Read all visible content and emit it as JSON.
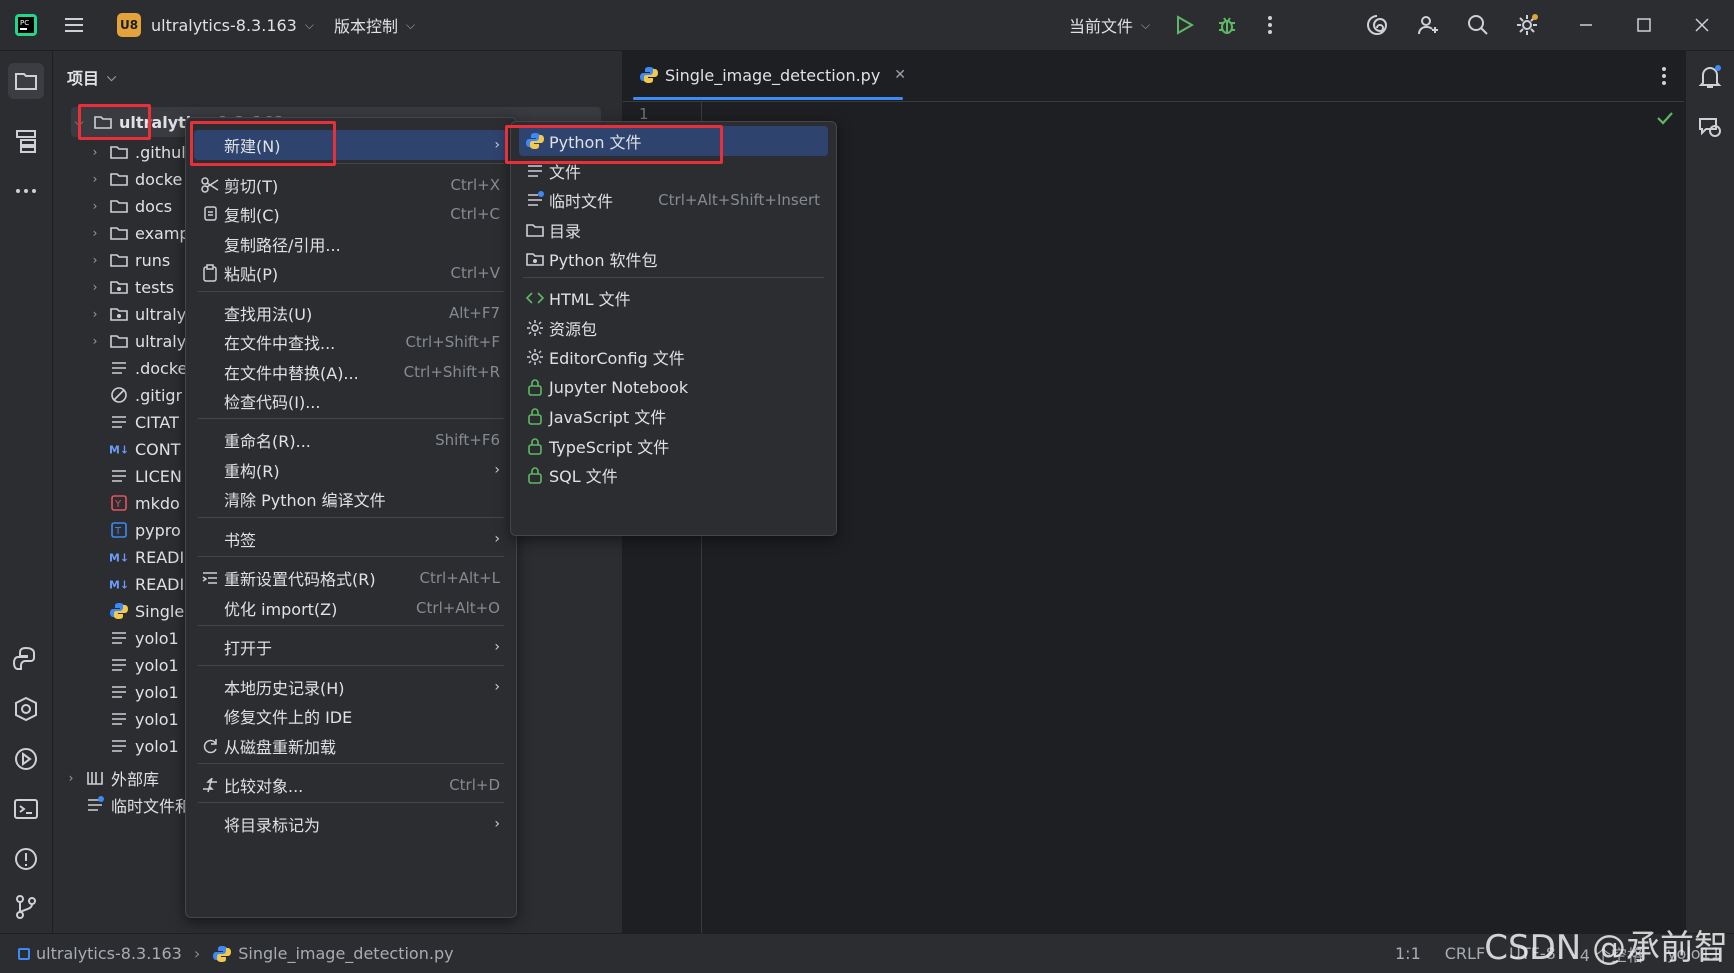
{
  "titlebar": {
    "project_badge": "U8",
    "project_name": "ultralytics-8.3.163",
    "vcs_label": "版本控制",
    "run_config": "当前文件"
  },
  "project_panel": {
    "title": "项目",
    "root_label": "ultralytics-8.3.163",
    "items": [
      {
        "label": ".githul",
        "type": "folder"
      },
      {
        "label": "docke",
        "type": "folder"
      },
      {
        "label": "docs",
        "type": "folder"
      },
      {
        "label": "examp",
        "type": "folder"
      },
      {
        "label": "runs",
        "type": "folder"
      },
      {
        "label": "tests",
        "type": "package"
      },
      {
        "label": "ultraly",
        "type": "package"
      },
      {
        "label": "ultraly",
        "type": "folder"
      },
      {
        "label": ".docke",
        "type": "text"
      },
      {
        "label": ".gitigr",
        "type": "ignore"
      },
      {
        "label": "CITAT",
        "type": "text"
      },
      {
        "label": "CONT",
        "type": "markdown"
      },
      {
        "label": "LICEN",
        "type": "text"
      },
      {
        "label": "mkdo",
        "type": "yaml"
      },
      {
        "label": "pypro",
        "type": "toml"
      },
      {
        "label": "READI",
        "type": "markdown"
      },
      {
        "label": "READI",
        "type": "markdown"
      },
      {
        "label": "Single",
        "type": "python"
      },
      {
        "label": "yolo1",
        "type": "text"
      },
      {
        "label": "yolo1",
        "type": "text"
      },
      {
        "label": "yolo1",
        "type": "text"
      },
      {
        "label": "yolo1",
        "type": "text"
      },
      {
        "label": "yolo1",
        "type": "text"
      }
    ],
    "external_libs": "外部库",
    "scratch": "临时文件和"
  },
  "editor": {
    "tab_label": "Single_image_detection.py",
    "line_number": "1"
  },
  "context_menu": {
    "items": [
      {
        "label": "新建(N)",
        "shortcut": "",
        "submenu": true
      },
      {
        "label": "剪切(T)",
        "shortcut": "Ctrl+X"
      },
      {
        "label": "复制(C)",
        "shortcut": "Ctrl+C"
      },
      {
        "label": "复制路径/引用...",
        "shortcut": ""
      },
      {
        "label": "粘贴(P)",
        "shortcut": "Ctrl+V"
      },
      {
        "label": "查找用法(U)",
        "shortcut": "Alt+F7"
      },
      {
        "label": "在文件中查找...",
        "shortcut": "Ctrl+Shift+F"
      },
      {
        "label": "在文件中替换(A)...",
        "shortcut": "Ctrl+Shift+R"
      },
      {
        "label": "检查代码(I)...",
        "shortcut": ""
      },
      {
        "label": "重命名(R)...",
        "shortcut": "Shift+F6"
      },
      {
        "label": "重构(R)",
        "shortcut": "",
        "submenu": true
      },
      {
        "label": "清除 Python 编译文件",
        "shortcut": ""
      },
      {
        "label": "书签",
        "shortcut": "",
        "submenu": true
      },
      {
        "label": "重新设置代码格式(R)",
        "shortcut": "Ctrl+Alt+L"
      },
      {
        "label": "优化 import(Z)",
        "shortcut": "Ctrl+Alt+O"
      },
      {
        "label": "打开于",
        "shortcut": "",
        "submenu": true
      },
      {
        "label": "本地历史记录(H)",
        "shortcut": "",
        "submenu": true
      },
      {
        "label": "修复文件上的 IDE",
        "shortcut": ""
      },
      {
        "label": "从磁盘重新加载",
        "shortcut": ""
      },
      {
        "label": "比较对象...",
        "shortcut": "Ctrl+D"
      },
      {
        "label": "将目录标记为",
        "shortcut": "",
        "submenu": true
      }
    ]
  },
  "new_submenu": {
    "items": [
      {
        "label": "Python 文件",
        "shortcut": ""
      },
      {
        "label": "文件",
        "shortcut": ""
      },
      {
        "label": "临时文件",
        "shortcut": "Ctrl+Alt+Shift+Insert"
      },
      {
        "label": "目录",
        "shortcut": ""
      },
      {
        "label": "Python 软件包",
        "shortcut": ""
      },
      {
        "label": "HTML 文件",
        "shortcut": ""
      },
      {
        "label": "资源包",
        "shortcut": ""
      },
      {
        "label": "EditorConfig 文件",
        "shortcut": ""
      },
      {
        "label": "Jupyter Notebook",
        "shortcut": ""
      },
      {
        "label": "JavaScript 文件",
        "shortcut": ""
      },
      {
        "label": "TypeScript 文件",
        "shortcut": ""
      },
      {
        "label": "SQL 文件",
        "shortcut": ""
      }
    ]
  },
  "statusbar": {
    "breadcrumb_project": "ultralytics-8.3.163",
    "breadcrumb_file": "Single_image_detection.py",
    "position": "1:1",
    "line_sep": "CRLF",
    "encoding": "UTF-8",
    "indent": "4 个空格",
    "interpreter": "yolo11"
  },
  "watermark": "CSDN @承前智",
  "colors": {
    "accent": "#2e436e",
    "highlight": "#e8303a",
    "badge": "#e3a33a"
  }
}
